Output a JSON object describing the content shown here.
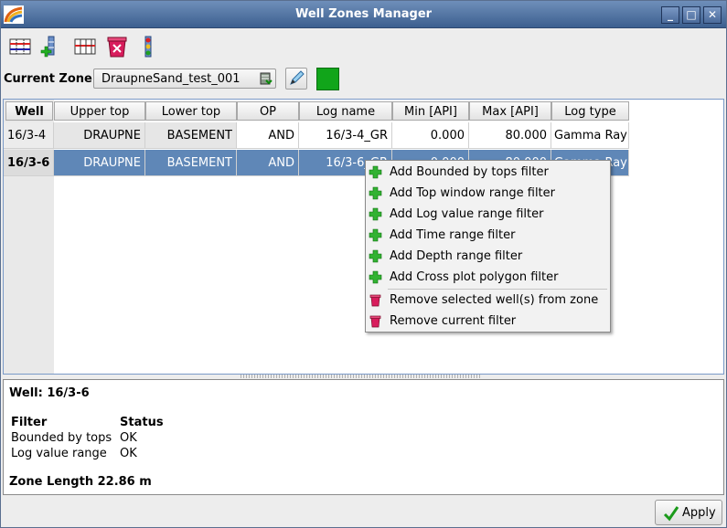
{
  "window": {
    "title": "Well Zones Manager",
    "minimize": "_",
    "maximize": "□",
    "close": "✕"
  },
  "toolbar": {
    "icons": [
      "zone-table-icon",
      "add-well-icon",
      "zone-filter-icon",
      "delete-zone-icon",
      "well-log-icon"
    ]
  },
  "zone": {
    "label": "Current Zone",
    "value": "DraupneSand_test_001",
    "color": "#11a51a"
  },
  "table": {
    "headers": [
      "Well",
      "Upper top",
      "Lower top",
      "OP",
      "Log name",
      "Min [API]",
      "Max [API]",
      "Log type"
    ],
    "rows": [
      {
        "well": "16/3-4",
        "upper": "DRAUPNE",
        "lower": "BASEMENT",
        "op": "AND",
        "log": "16/3-4_GR",
        "min": "0.000",
        "max": "80.000",
        "type": "Gamma Ray"
      },
      {
        "well": "16/3-6",
        "upper": "DRAUPNE",
        "lower": "BASEMENT",
        "op": "AND",
        "log": "16/3-6_GR",
        "min": "0.000",
        "max": "80.000",
        "type": "Gamma Ray"
      }
    ]
  },
  "context_menu": {
    "add_items": [
      "Add Bounded by tops filter",
      "Add Top window range filter",
      "Add Log value range filter",
      "Add Time range filter",
      "Add Depth range filter",
      "Add Cross plot polygon filter"
    ],
    "remove_items": [
      "Remove selected well(s) from zone",
      "Remove current filter"
    ]
  },
  "info": {
    "well_line": "Well: 16/3-6",
    "filter_header": "Filter",
    "status_header": "Status",
    "filters": [
      {
        "name": "Bounded by tops",
        "status": "OK"
      },
      {
        "name": "Log value range",
        "status": "OK"
      }
    ],
    "zone_length": "Zone Length 22.86 m"
  },
  "footer": {
    "apply_label": "Apply"
  }
}
